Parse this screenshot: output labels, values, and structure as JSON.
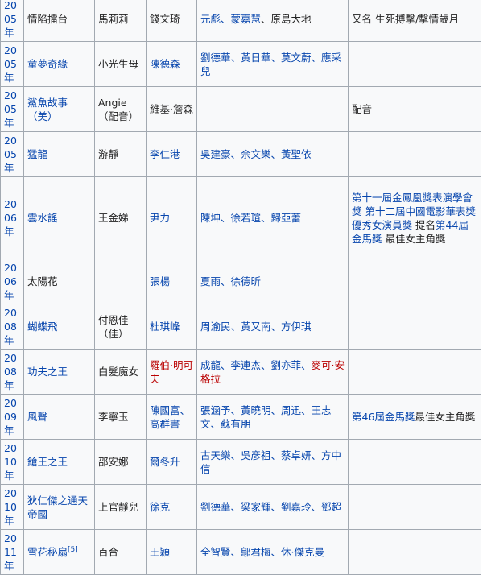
{
  "rows": [
    {
      "year": "2005\n年",
      "title": "情陷擂台",
      "role": "馬莉莉",
      "director": "錢文琦",
      "costars": [
        {
          "t": "元彪",
          "c": "link"
        },
        {
          "t": "、",
          "c": "link"
        },
        {
          "t": "蒙嘉慧",
          "c": "link"
        },
        {
          "t": "、原島大地",
          "c": "plain"
        }
      ],
      "note": "又名 生死搏擊/擊情歲月"
    },
    {
      "year": "2005\n年",
      "title": "童夢奇緣",
      "title_link": true,
      "role": "小光生母",
      "director": "陳德森",
      "director_link": true,
      "costars": [
        {
          "t": "劉德華、黃日華、莫文蔚、應采兒",
          "c": "link"
        }
      ],
      "note": ""
    },
    {
      "year": "2005\n年",
      "title": "鯊魚故事（美）",
      "title_link": true,
      "role": "Angie（配音）",
      "director": "維基·詹森",
      "costars": [],
      "note": "配音"
    },
    {
      "year": "2005\n年",
      "title": "猛龍",
      "title_link": true,
      "role": "游靜",
      "director": "李仁港",
      "director_link": true,
      "costars": [
        {
          "t": "吳建豪、佘文樂、黃聖依",
          "c": "link"
        }
      ],
      "note": ""
    },
    {
      "year": "2006\n年",
      "title": "雲水謠",
      "title_link": true,
      "role": "王金娣",
      "director": "尹力",
      "director_link": true,
      "costars": [
        {
          "t": "陳坤、徐若瑄、歸亞蕾",
          "c": "link"
        }
      ],
      "note_parts": [
        {
          "t": "第十一屆金鳳凰獎表演學會獎",
          "c": "link"
        },
        {
          "t": " 第十二屆中國電影華表獎優秀女演員獎 ",
          "c": "link"
        },
        {
          "t": "提名",
          "c": "plain"
        },
        {
          "t": "第44屆金馬獎",
          "c": "link"
        },
        {
          "t": " 最佳女主角獎",
          "c": "plain"
        }
      ]
    },
    {
      "year": "2006\n年",
      "title": "太陽花",
      "role": "",
      "director": "張楊",
      "director_link": true,
      "costars": [
        {
          "t": "夏雨、徐德昕",
          "c": "link"
        }
      ],
      "note": ""
    },
    {
      "year": "2008\n年",
      "title": "蝴蝶飛",
      "title_link": true,
      "role": "付恩佳（佳）",
      "director": "杜琪峰",
      "director_link": true,
      "costars": [
        {
          "t": "周渝民、黃又南、方伊琪",
          "c": "link"
        }
      ],
      "note": ""
    },
    {
      "year": "2008\n年",
      "title": "功夫之王",
      "title_link": true,
      "role": "白髮魔女",
      "director": "羅伯·明可夫",
      "director_red": true,
      "costars": [
        {
          "t": "成龍、李連杰、劉亦菲、",
          "c": "link"
        },
        {
          "t": "麥可·安格拉",
          "c": "red"
        }
      ],
      "note": ""
    },
    {
      "year": "2009\n年",
      "title": "風聲",
      "title_link": true,
      "role": "李寧玉",
      "director": "陳國富、高群書",
      "director_link": true,
      "costars": [
        {
          "t": "張涵予、黃曉明、周迅、王志文、蘇有朋",
          "c": "link"
        }
      ],
      "note_parts": [
        {
          "t": "第46屆金馬獎",
          "c": "link"
        },
        {
          "t": "最佳女主角獎",
          "c": "plain"
        }
      ]
    },
    {
      "year": "2010\n年",
      "title": "鎗王之王",
      "title_link": true,
      "role": "邵安娜",
      "director": "爾冬升",
      "director_link": true,
      "costars": [
        {
          "t": "古天樂、吳彥祖、蔡卓妍、方中信",
          "c": "link"
        }
      ],
      "note": ""
    },
    {
      "year": "2010\n年",
      "title": "狄仁傑之通天帝國",
      "title_link": true,
      "role": "上官靜兒",
      "director": "徐克",
      "director_link": true,
      "costars": [
        {
          "t": "劉德華、梁家輝、劉嘉玲、鄧超",
          "c": "link"
        }
      ],
      "note": ""
    },
    {
      "year": "2011\n年",
      "title": "雪花秘扇",
      "title_link": true,
      "title_sup": "[5]",
      "role": "百合",
      "director": "王穎",
      "director_link": true,
      "costars": [
        {
          "t": "全智賢、鄔君梅、休·傑克曼",
          "c": "link"
        }
      ],
      "note": ""
    }
  ]
}
